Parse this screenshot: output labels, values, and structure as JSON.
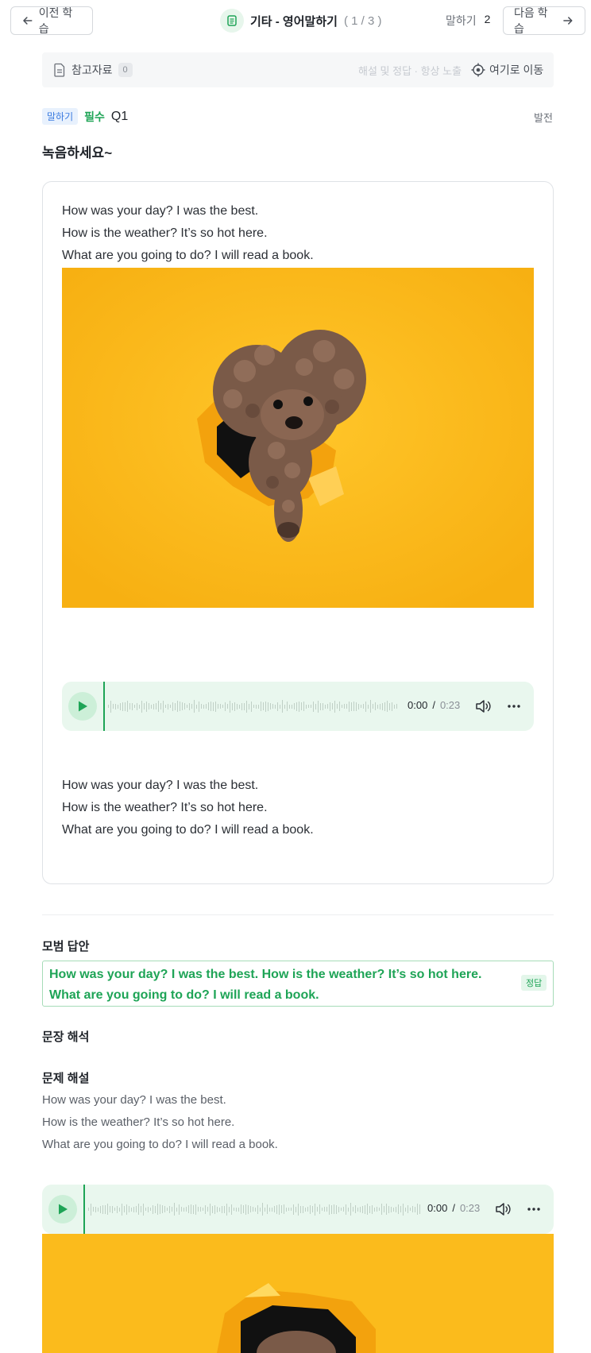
{
  "header": {
    "prev_label": "이전 학습",
    "title": "기타 - 영어말하기",
    "count": "( 1 / 3 )",
    "speak_label": "말하기",
    "speak_count": "2",
    "next_label": "다음 학습"
  },
  "refbar": {
    "label": "참고자료",
    "count": "0",
    "hint": "해설 및 정답 · 항상 노출",
    "goto_label": "여기로 이동"
  },
  "question": {
    "type_tag": "말하기",
    "required": "필수",
    "number": "Q1",
    "level": "발전",
    "prompt": "녹음하세요~"
  },
  "card": {
    "lines_top": [
      "How was your day? I was the best.",
      "How is the weather? It’s so hot here.",
      "What are you going to do? I will read a book."
    ],
    "lines_bottom": [
      "How was your day? I was the best.",
      "How is the weather? It’s so hot here.",
      "What are you going to do? I will read a book."
    ],
    "image": "poodle-through-torn-yellow-paper"
  },
  "player1": {
    "current": "0:00",
    "sep": "/",
    "duration": "0:23",
    "progress": 0
  },
  "model_answer": {
    "title": "모범 답안",
    "text": "How was your day? I was the best. How is the weather? It’s so hot here. What are you going to do? I will read a book.",
    "tag": "정답"
  },
  "translation": {
    "title": "문장 해석"
  },
  "explanation": {
    "title": "문제 해설",
    "lines": [
      "How was your day? I was the best.",
      "How is the weather? It’s so hot here.",
      "What are you going to do? I will read a book."
    ]
  },
  "player2": {
    "current": "0:00",
    "sep": "/",
    "duration": "0:23",
    "progress": 0
  },
  "colors": {
    "accent": "#1ea456",
    "player_bg": "#e9f7ee",
    "image_bg": "#fbbb1c",
    "tag_blue": "#3b7be0"
  }
}
